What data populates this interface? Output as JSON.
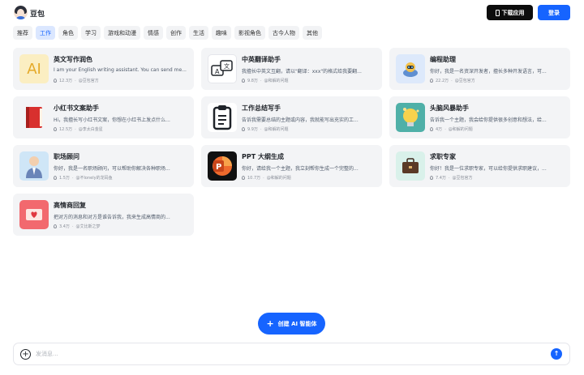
{
  "app": {
    "brand": "豆包"
  },
  "header": {
    "download_label": "下载应用",
    "login_label": "登录"
  },
  "tabs": [
    {
      "label": "推荐",
      "active": false
    },
    {
      "label": "工作",
      "active": true
    },
    {
      "label": "角色",
      "active": false
    },
    {
      "label": "学习",
      "active": false
    },
    {
      "label": "游戏和动漫",
      "active": false
    },
    {
      "label": "情感",
      "active": false
    },
    {
      "label": "创作",
      "active": false
    },
    {
      "label": "生活",
      "active": false
    },
    {
      "label": "趣味",
      "active": false
    },
    {
      "label": "影视角色",
      "active": false
    },
    {
      "label": "古今人物",
      "active": false
    },
    {
      "label": "其他",
      "active": false
    }
  ],
  "bots": [
    {
      "title": "英文写作润色",
      "desc": "I am your English writing assistant. You can send me...",
      "views": "12.3万",
      "author": "@豆包官方",
      "icon": "ai-letters-icon"
    },
    {
      "title": "中英翻译助手",
      "desc": "我擅长中英文互翻，请以\"翻译：xxx\"的格式给我要翻...",
      "views": "9.8万",
      "author": "@和解的问题",
      "icon": "translate-icon"
    },
    {
      "title": "编程助理",
      "desc": "你好，我是一名资深开发者，擅长多种开发语言，可...",
      "views": "22.2万",
      "author": "@豆包官方",
      "icon": "robot-icon"
    },
    {
      "title": "小红书文案助手",
      "desc": "Hi，我擅长写小红书文案，你想在小红书上发点什么...",
      "views": "12.5万",
      "author": "@李太白金星",
      "icon": "book-icon"
    },
    {
      "title": "工作总结写手",
      "desc": "告诉我需要总结的主题或内容，我就能写出充实的工...",
      "views": "9.9万",
      "author": "@和解的问题",
      "icon": "clipboard-icon"
    },
    {
      "title": "头脑风暴助手",
      "desc": "告诉我一个主题，我会给你提供很多创意和想法，给...",
      "views": "4万",
      "author": "@和解的问题",
      "icon": "lightbulb-icon"
    },
    {
      "title": "职场顾问",
      "desc": "你好，我是一名职场顾问，可以帮助你解决各种职场...",
      "views": "1.5万",
      "author": "@不lonely的龙码鱼",
      "icon": "businessman-icon"
    },
    {
      "title": "PPT 大纲生成",
      "desc": "你好，请给我一个主题，我立刻帮你生成一个完整的...",
      "views": "10.7万",
      "author": "@和解的问题",
      "icon": "powerpoint-icon"
    },
    {
      "title": "求职专家",
      "desc": "你好！我是一位求职专家，可以给你提供求职建议，...",
      "views": "7.4万",
      "author": "@豆包官方",
      "icon": "briefcase-icon"
    },
    {
      "title": "高情商回复",
      "desc": "把对方的消息和对方是谁告诉我，我来生成高情商的...",
      "views": "3.4万",
      "author": "@艾比斯之梦",
      "icon": "heart-letter-icon"
    }
  ],
  "create_label": "创建 AI 智能体",
  "chat": {
    "placeholder": "发消息..."
  },
  "colors": {
    "accent": "#1664ff",
    "card_bg": "#f3f4f6",
    "tab_active_bg": "#dbe7ff"
  }
}
